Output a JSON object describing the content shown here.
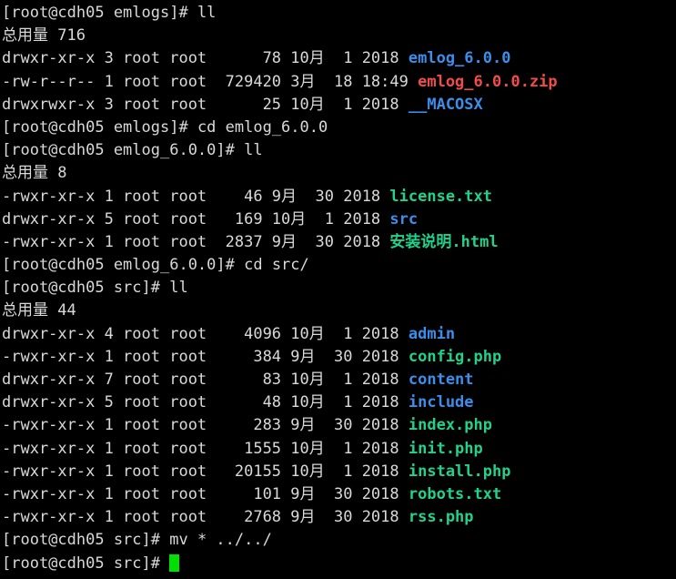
{
  "terminal": {
    "background": "#000000",
    "foreground": "#d9d9d9",
    "colors": {
      "directory": "#3b8eea",
      "executable": "#23d18b",
      "archive": "#f14c4c",
      "cursor": "#00e000"
    },
    "host": "cdh05",
    "user": "root",
    "lines": [
      {
        "type": "prompt",
        "prompt": "[root@cdh05 emlogs]# ",
        "command": "ll"
      },
      {
        "type": "total",
        "text": "总用量 716"
      },
      {
        "type": "listing",
        "perms": "drwxr-xr-x",
        "links": "3",
        "owner": "root",
        "group": "root",
        "size": "78",
        "month": "10月",
        "day": "1",
        "year": "2018",
        "name": "emlog_6.0.0",
        "color": "directory"
      },
      {
        "type": "listing",
        "perms": "-rw-r--r--",
        "links": "1",
        "owner": "root",
        "group": "root",
        "size": "729420",
        "month": "3月",
        "day": "18",
        "year": "18:49",
        "name": "emlog_6.0.0.zip",
        "color": "archive"
      },
      {
        "type": "listing",
        "perms": "drwxrwxr-x",
        "links": "3",
        "owner": "root",
        "group": "root",
        "size": "25",
        "month": "10月",
        "day": "1",
        "year": "2018",
        "name": "__MACOSX",
        "color": "directory"
      },
      {
        "type": "prompt",
        "prompt": "[root@cdh05 emlogs]# ",
        "command": "cd emlog_6.0.0"
      },
      {
        "type": "prompt",
        "prompt": "[root@cdh05 emlog_6.0.0]# ",
        "command": "ll"
      },
      {
        "type": "total",
        "text": "总用量 8"
      },
      {
        "type": "listing2",
        "perms": "-rwxr-xr-x",
        "links": "1",
        "owner": "root",
        "group": "root",
        "size": "46",
        "month": "9月",
        "day": "30",
        "year": "2018",
        "name": "license.txt",
        "color": "executable"
      },
      {
        "type": "listing2",
        "perms": "drwxr-xr-x",
        "links": "5",
        "owner": "root",
        "group": "root",
        "size": "169",
        "month": "10月",
        "day": "1",
        "year": "2018",
        "name": "src",
        "color": "directory"
      },
      {
        "type": "listing2",
        "perms": "-rwxr-xr-x",
        "links": "1",
        "owner": "root",
        "group": "root",
        "size": "2837",
        "month": "9月",
        "day": "30",
        "year": "2018",
        "name": "安装说明.html",
        "color": "executable"
      },
      {
        "type": "prompt",
        "prompt": "[root@cdh05 emlog_6.0.0]# ",
        "command": "cd src/"
      },
      {
        "type": "prompt",
        "prompt": "[root@cdh05 src]# ",
        "command": "ll"
      },
      {
        "type": "total",
        "text": "总用量 44"
      },
      {
        "type": "listing",
        "perms": "drwxr-xr-x",
        "links": "4",
        "owner": "root",
        "group": "root",
        "size": "4096",
        "month": "10月",
        "day": "1",
        "year": "2018",
        "name": "admin",
        "color": "directory"
      },
      {
        "type": "listing",
        "perms": "-rwxr-xr-x",
        "links": "1",
        "owner": "root",
        "group": "root",
        "size": "384",
        "month": "9月",
        "day": "30",
        "year": "2018",
        "name": "config.php",
        "color": "executable"
      },
      {
        "type": "listing",
        "perms": "drwxr-xr-x",
        "links": "7",
        "owner": "root",
        "group": "root",
        "size": "83",
        "month": "10月",
        "day": "1",
        "year": "2018",
        "name": "content",
        "color": "directory"
      },
      {
        "type": "listing",
        "perms": "drwxr-xr-x",
        "links": "5",
        "owner": "root",
        "group": "root",
        "size": "48",
        "month": "10月",
        "day": "1",
        "year": "2018",
        "name": "include",
        "color": "directory"
      },
      {
        "type": "listing",
        "perms": "-rwxr-xr-x",
        "links": "1",
        "owner": "root",
        "group": "root",
        "size": "283",
        "month": "9月",
        "day": "30",
        "year": "2018",
        "name": "index.php",
        "color": "executable"
      },
      {
        "type": "listing",
        "perms": "-rwxr-xr-x",
        "links": "1",
        "owner": "root",
        "group": "root",
        "size": "1555",
        "month": "10月",
        "day": "1",
        "year": "2018",
        "name": "init.php",
        "color": "executable"
      },
      {
        "type": "listing",
        "perms": "-rwxr-xr-x",
        "links": "1",
        "owner": "root",
        "group": "root",
        "size": "20155",
        "month": "10月",
        "day": "1",
        "year": "2018",
        "name": "install.php",
        "color": "executable"
      },
      {
        "type": "listing",
        "perms": "-rwxr-xr-x",
        "links": "1",
        "owner": "root",
        "group": "root",
        "size": "101",
        "month": "9月",
        "day": "30",
        "year": "2018",
        "name": "robots.txt",
        "color": "executable"
      },
      {
        "type": "listing",
        "perms": "-rwxr-xr-x",
        "links": "1",
        "owner": "root",
        "group": "root",
        "size": "2768",
        "month": "9月",
        "day": "30",
        "year": "2018",
        "name": "rss.php",
        "color": "executable"
      },
      {
        "type": "prompt",
        "prompt": "[root@cdh05 src]# ",
        "command": "mv * ../../"
      },
      {
        "type": "prompt-cursor",
        "prompt": "[root@cdh05 src]# ",
        "command": ""
      }
    ]
  }
}
